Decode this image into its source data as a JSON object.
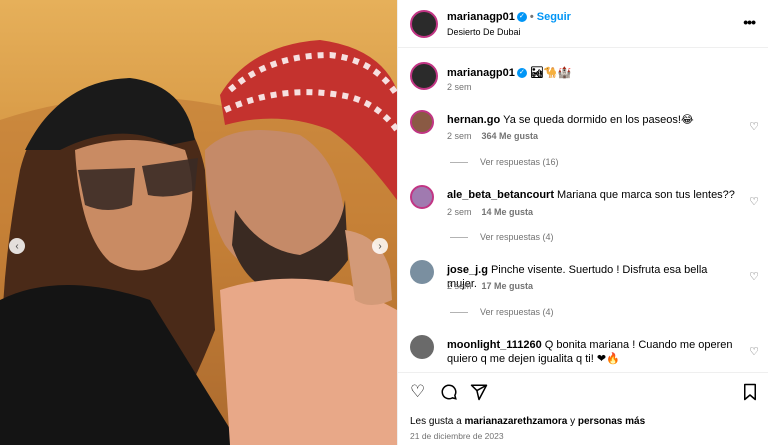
{
  "post": {
    "username": "marianagp01",
    "follow_label": "Seguir",
    "location": "Desierto De Dubai",
    "more_label": "•••",
    "caption_emojis": "🏜🐪🏰",
    "caption_time": "2 sem"
  },
  "comments": [
    {
      "user": "hernan.go",
      "text": "Ya se queda dormido en los paseos!😂",
      "time": "2 sem",
      "likes": "364 Me gusta",
      "replies": "Ver respuestas (16)",
      "avatar_color": "#8a5a44"
    },
    {
      "user": "ale_beta_betancourt",
      "text": "Mariana que marca son tus lentes??",
      "time": "2 sem",
      "likes": "14 Me gusta",
      "replies": "Ver respuestas (4)",
      "avatar_color": "#a07ab0"
    },
    {
      "user": "jose_j.g",
      "text": "Pinche visente. Suertudo ! Disfruta esa bella mujer.",
      "time": "2 sem",
      "likes": "17 Me gusta",
      "replies": "Ver respuestas (4)",
      "avatar_color": "#7a8fa0"
    },
    {
      "user": "moonlight_111260",
      "text": "Q bonita mariana ! Cuando me operen quiero q me dejen igualita q ti! ❤🔥",
      "avatar_color": "#6a6a6a"
    }
  ],
  "footer": {
    "likes_prefix": "Les gusta a",
    "likes_user": "marianazarethzamora",
    "likes_conj": "y",
    "likes_others": "personas más",
    "date": "21 de diciembre de 2023"
  },
  "icons": {
    "like": "heart-icon",
    "comment": "comment-icon",
    "share": "share-icon",
    "save": "bookmark-icon",
    "verified": "verified-icon"
  },
  "colors": {
    "accent": "#0095f6",
    "muted": "#737373",
    "story_ring": "#c13584"
  }
}
